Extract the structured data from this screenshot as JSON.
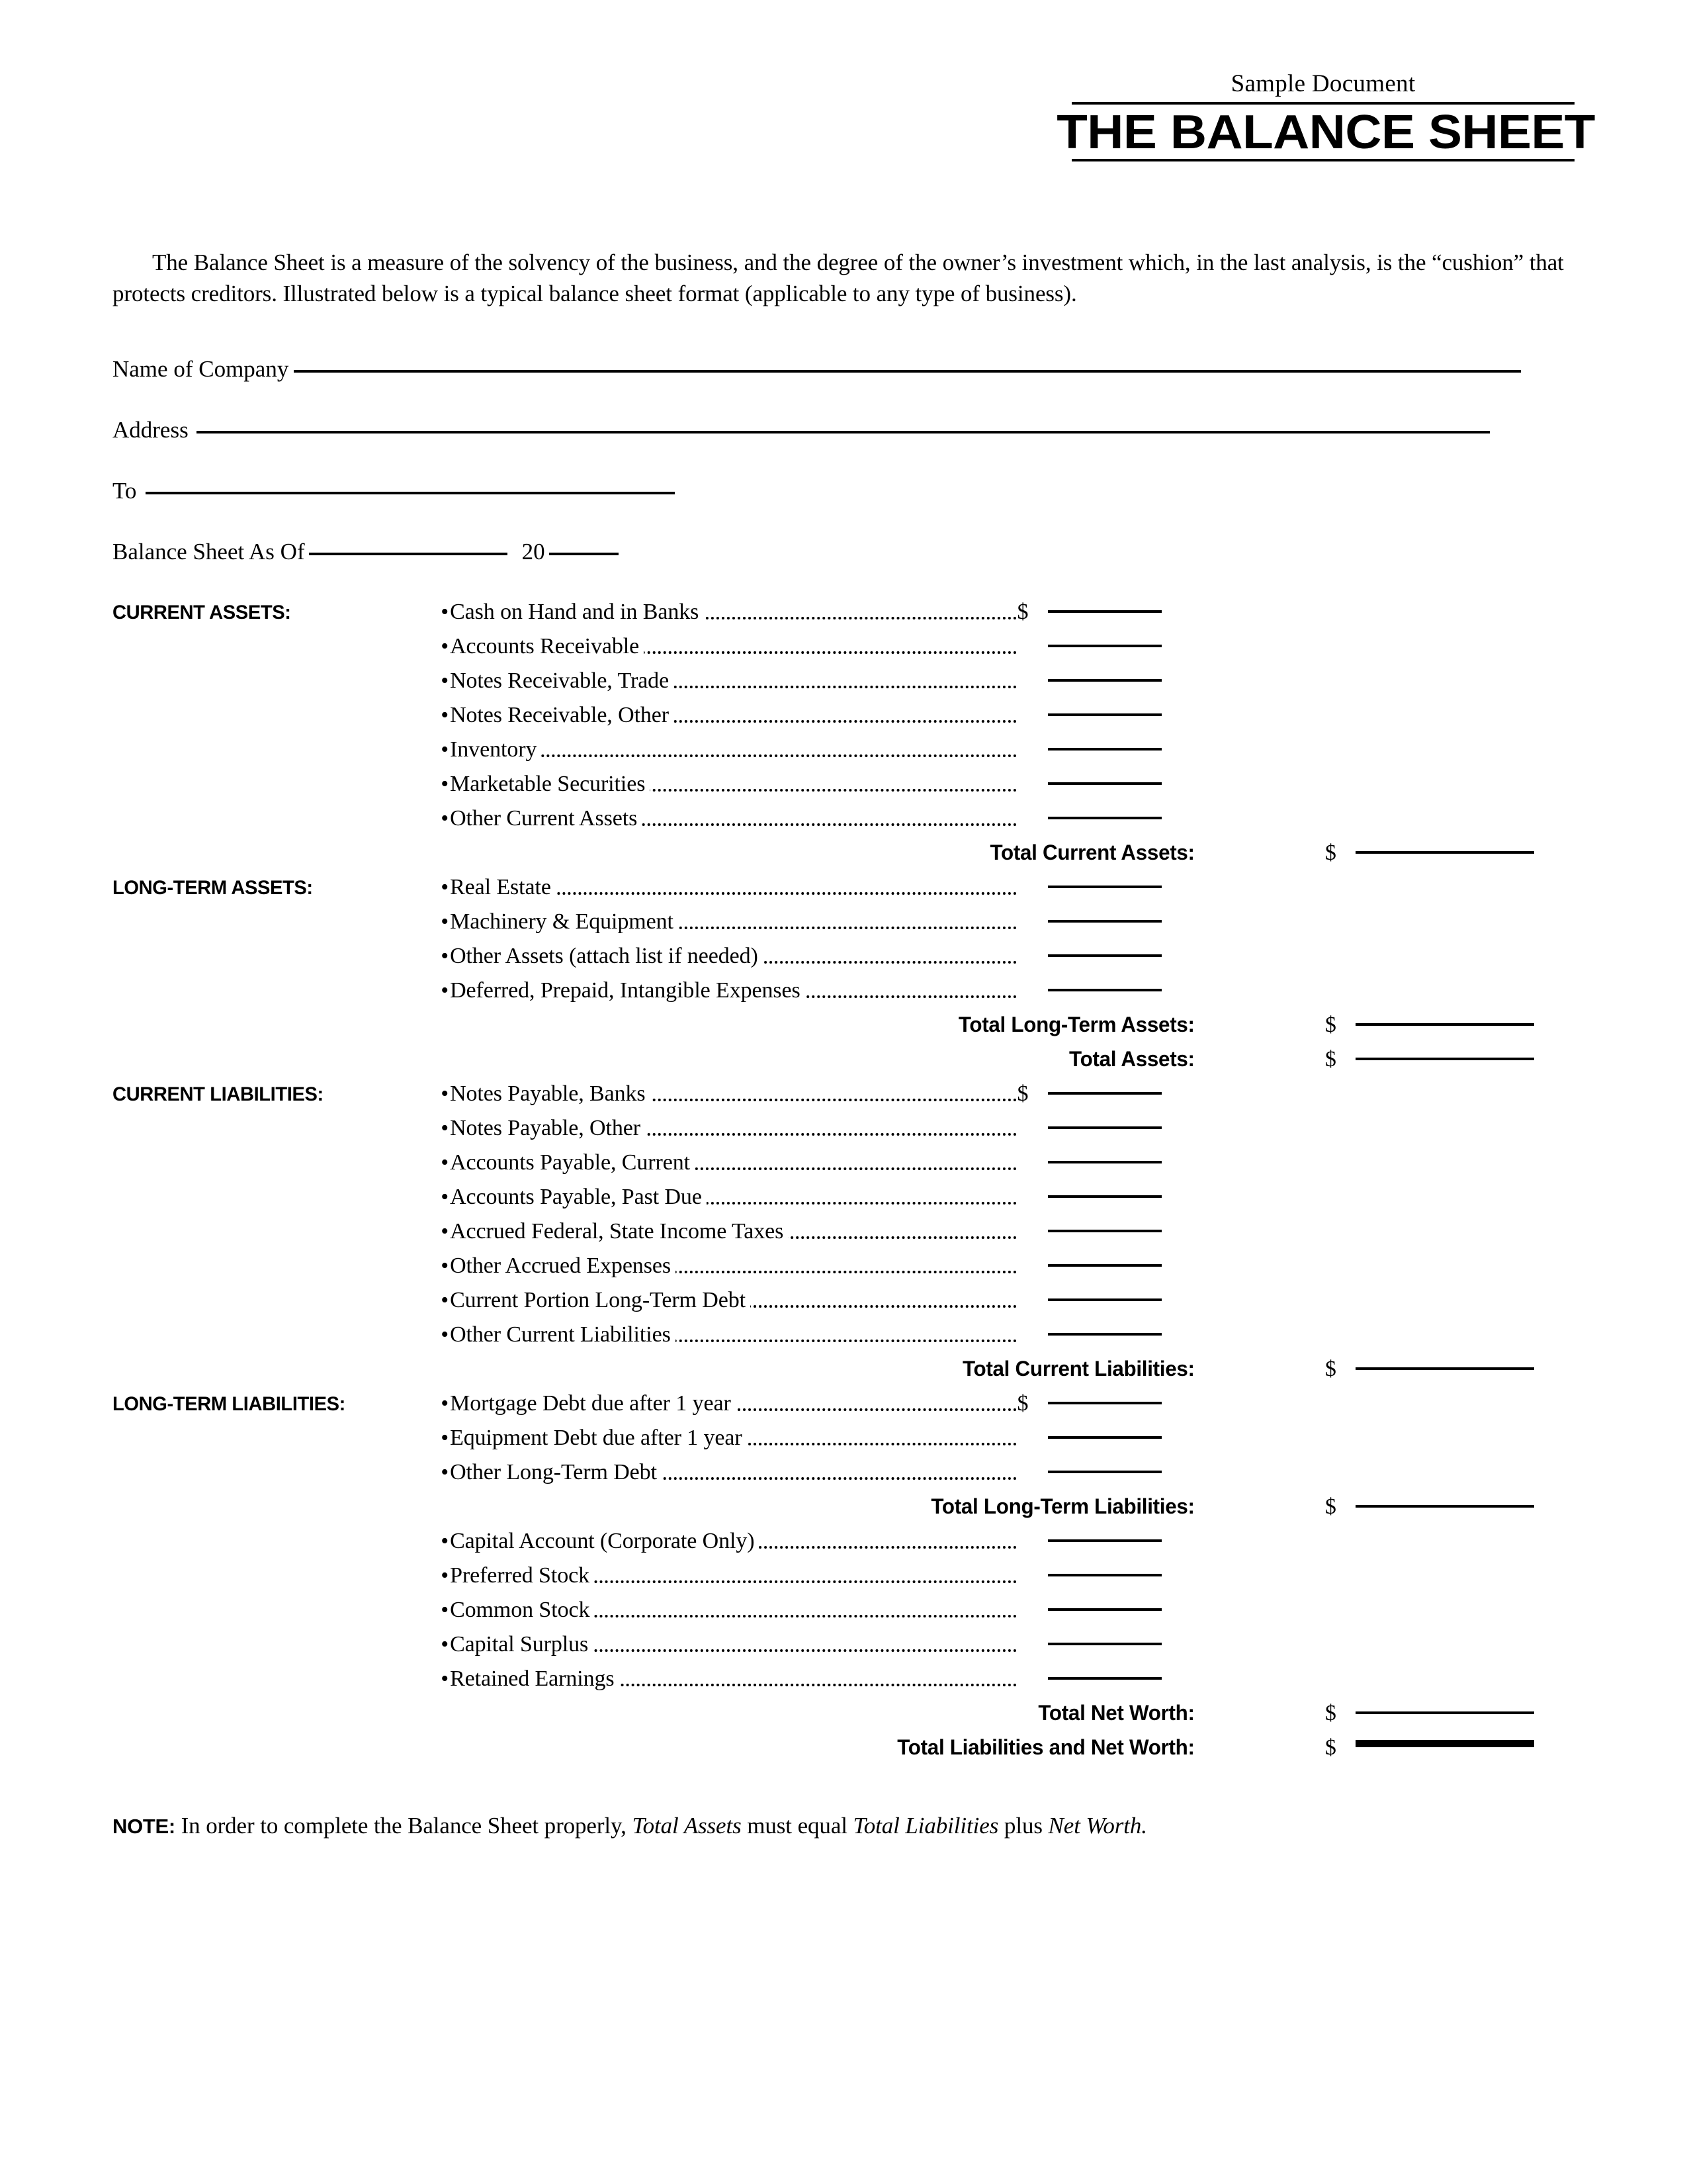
{
  "header": {
    "kicker": "Sample Document",
    "title": "THE BALANCE SHEET"
  },
  "intro": {
    "paragraph": "The Balance Sheet is a measure of the solvency of the business, and the degree of the owner’s investment which, in the last analysis, is the “cushion” that protects creditors. Illustrated below is a typical balance sheet format (applicable to any type of business)."
  },
  "form_fields": {
    "company": "Name of Company",
    "address": "Address",
    "to": "To",
    "as_of": "Balance Sheet As Of",
    "year_prefix": "20"
  },
  "symbols": {
    "bullet": "•",
    "dollar": "$"
  },
  "sections": [
    {
      "label": "CURRENT ASSETS:",
      "items": [
        "Cash on Hand and in Banks",
        "Accounts Receivable",
        "Notes Receivable, Trade",
        "Notes Receivable, Other",
        "Inventory",
        "Marketable Securities",
        "Other Current Assets"
      ],
      "totals": [
        "Total Current Assets:"
      ]
    },
    {
      "label": "LONG-TERM ASSETS:",
      "items": [
        "Real Estate",
        "Machinery & Equipment",
        "Other Assets (attach list if needed)",
        "Deferred, Prepaid, Intangible Expenses"
      ],
      "totals": [
        "Total Long-Term Assets:",
        "Total Assets:"
      ]
    },
    {
      "label": "CURRENT LIABILITIES:",
      "items": [
        "Notes Payable, Banks",
        "Notes Payable, Other",
        "Accounts Payable, Current",
        "Accounts Payable, Past Due",
        "Accrued Federal, State Income Taxes",
        "Other Accrued Expenses",
        "Current Portion Long-Term Debt",
        "Other Current Liabilities"
      ],
      "totals": [
        "Total Current Liabilities:"
      ]
    },
    {
      "label": "LONG-TERM LIABILITIES:",
      "items": [
        "Mortgage Debt due after 1 year",
        "Equipment Debt due after 1 year",
        "Other Long-Term Debt"
      ],
      "totals": [
        "Total Long-Term Liabilities:"
      ]
    },
    {
      "label": "",
      "items": [
        "Capital Account (Corporate Only)",
        "Preferred Stock",
        "Common Stock",
        "Capital Surplus",
        "Retained Earnings"
      ],
      "totals": [
        "Total Net Worth:",
        "Total Liabilities and Net Worth:"
      ]
    }
  ],
  "note": {
    "keyword": "NOTE:",
    "part1": "In order to complete the Balance Sheet properly,",
    "em1": "Total Assets",
    "part2": "must equal",
    "em2": "Total Liabilities",
    "part3": "plus",
    "em3": "Net Worth."
  }
}
